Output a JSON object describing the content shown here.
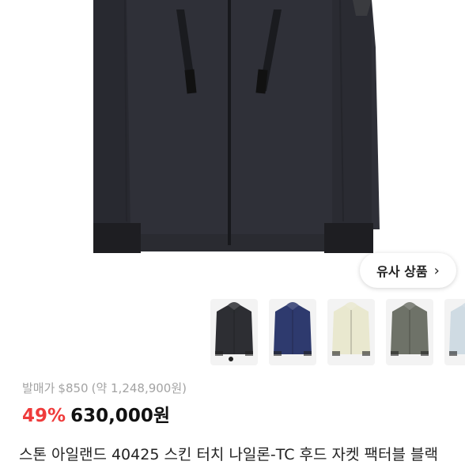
{
  "similar_button": {
    "label": "유사 상품",
    "icon": "chevron-right-icon"
  },
  "thumbnails": [
    {
      "name": "thumb-black",
      "color": "#2d2e33"
    },
    {
      "name": "thumb-navy",
      "color": "#2e3a6e"
    },
    {
      "name": "thumb-cream",
      "color": "#e9e8cf"
    },
    {
      "name": "thumb-olive",
      "color": "#6e7268"
    },
    {
      "name": "thumb-lightblue",
      "color": "#cfdbe3"
    }
  ],
  "pager": {
    "active_index": 0
  },
  "pricing": {
    "retail_label": "발매가",
    "retail_price": "$850",
    "retail_converted": "(약 1,248,900원)",
    "discount": "49%",
    "price": "630,000원"
  },
  "product": {
    "title": "스톤 아일랜드 40425 스킨 터치 나일론-TC 후드 자켓 팩터블 블랙"
  },
  "colors": {
    "discount": "#ef3b3b",
    "jacket": "#2f3038"
  }
}
